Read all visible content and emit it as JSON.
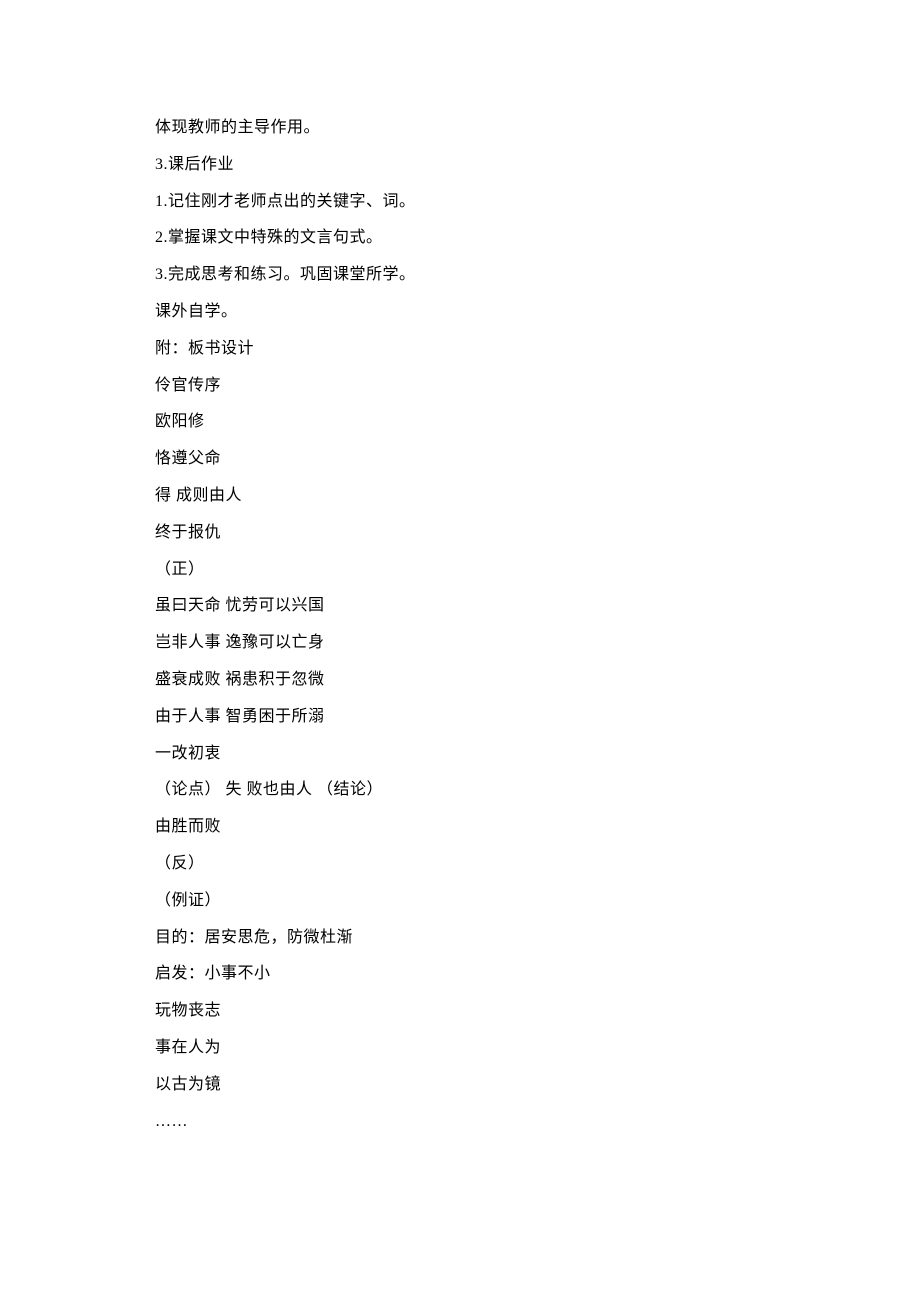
{
  "lines": [
    "体现教师的主导作用。",
    "3.课后作业",
    "1.记住刚才老师点出的关键字、词。",
    "2.掌握课文中特殊的文言句式。",
    "3.完成思考和练习。巩固课堂所学。",
    "课外自学。",
    "附：板书设计",
    "伶官传序",
    "欧阳修",
    "恪遵父命",
    "得 成则由人",
    "终于报仇",
    "（正）",
    "虽曰天命 忧劳可以兴国",
    "岂非人事 逸豫可以亡身",
    "盛衰成败 祸患积于忽微",
    "由于人事 智勇困于所溺",
    "一改初衷",
    "（论点） 失 败也由人 （结论）",
    "由胜而败",
    "（反）",
    "（例证）",
    "目的：居安思危，防微杜渐",
    "启发：小事不小",
    "玩物丧志",
    "事在人为",
    "以古为镜",
    "……"
  ]
}
